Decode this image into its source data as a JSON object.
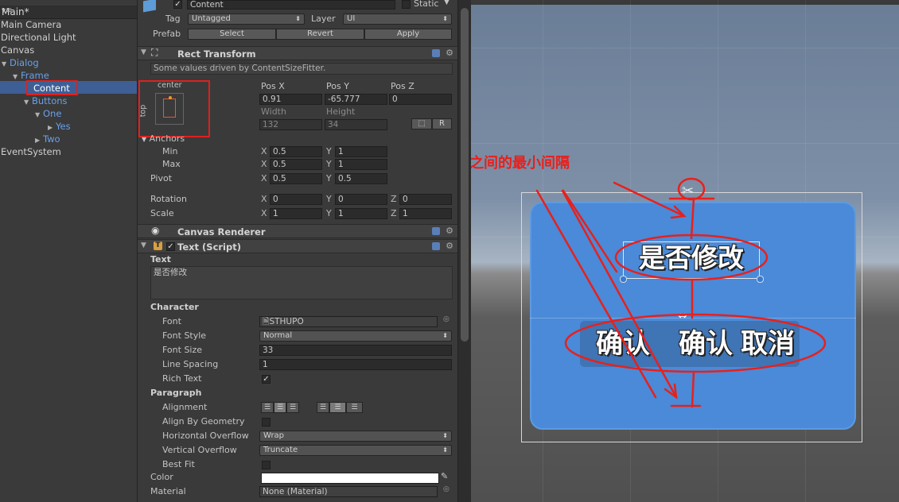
{
  "hierarchy": {
    "title": "Main*",
    "items": [
      {
        "label": "Main Camera"
      },
      {
        "label": "Directional Light"
      },
      {
        "label": "Canvas"
      },
      {
        "label": "Dialog"
      },
      {
        "label": "Frame"
      },
      {
        "label": "Content"
      },
      {
        "label": "Buttons"
      },
      {
        "label": "One"
      },
      {
        "label": "Yes"
      },
      {
        "label": "Two"
      },
      {
        "label": "EventSystem"
      }
    ]
  },
  "inspector": {
    "object_name": "Content",
    "static_label": "Static",
    "tag_label": "Tag",
    "tag_value": "Untagged",
    "layer_label": "Layer",
    "layer_value": "UI",
    "prefab_label": "Prefab",
    "prefab_buttons": [
      "Select",
      "Revert",
      "Apply"
    ],
    "rect_transform": {
      "title": "Rect Transform",
      "note": "Some values driven by ContentSizeFitter.",
      "anchor_preset_h": "center",
      "anchor_preset_v": "top",
      "pos_x_label": "Pos X",
      "pos_y_label": "Pos Y",
      "pos_z_label": "Pos Z",
      "pos_x": "0.91",
      "pos_y": "-65.777",
      "pos_z": "0",
      "width_label": "Width",
      "height_label": "Height",
      "width": "132",
      "height": "34",
      "r_button": "R",
      "anchors_label": "Anchors",
      "min_label": "Min",
      "max_label": "Max",
      "min_x": "0.5",
      "min_y": "1",
      "max_x": "0.5",
      "max_y": "1",
      "pivot_label": "Pivot",
      "pivot_x": "0.5",
      "pivot_y": "0.5",
      "rotation_label": "Rotation",
      "rot_x": "0",
      "rot_y": "0",
      "rot_z": "0",
      "scale_label": "Scale",
      "scale_x": "1",
      "scale_y": "1",
      "scale_z": "1",
      "x": "X",
      "y": "Y",
      "z": "Z"
    },
    "canvas_renderer": {
      "title": "Canvas Renderer"
    },
    "text_script": {
      "title": "Text (Script)",
      "text_label": "Text",
      "text_value": "是否修改",
      "character_label": "Character",
      "font_label": "Font",
      "font_value": "STHUPO",
      "font_style_label": "Font Style",
      "font_style_value": "Normal",
      "font_size_label": "Font Size",
      "font_size_value": "33",
      "line_spacing_label": "Line Spacing",
      "line_spacing_value": "1",
      "rich_text_label": "Rich Text",
      "rich_text_checked": true,
      "paragraph_label": "Paragraph",
      "alignment_label": "Alignment",
      "align_by_geometry_label": "Align By Geometry",
      "h_overflow_label": "Horizontal Overflow",
      "h_overflow_value": "Wrap",
      "v_overflow_label": "Vertical Overflow",
      "v_overflow_value": "Truncate",
      "best_fit_label": "Best Fit",
      "color_label": "Color",
      "color_value": "#ffffff",
      "material_label": "Material",
      "material_value": "None (Material)"
    }
  },
  "scene": {
    "annotation": "确定元素之间的最小间隔",
    "title_text": "是否修改",
    "buttons_text": [
      "确认",
      "确认",
      "取消"
    ],
    "panel_color": "#4a8ad8",
    "annotation_color": "#e8201c"
  }
}
